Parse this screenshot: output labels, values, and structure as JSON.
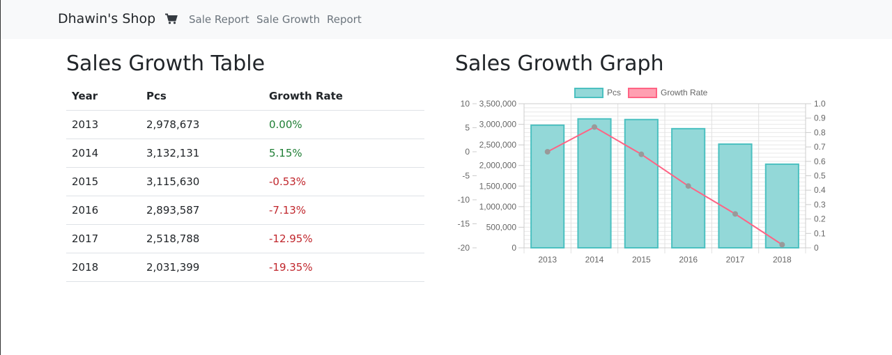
{
  "nav": {
    "brand": "Dhawin's Shop",
    "links": [
      "Sale Report",
      "Sale Growth",
      "Report"
    ]
  },
  "table_section": {
    "title": "Sales Growth Table",
    "headers": [
      "Year",
      "Pcs",
      "Growth Rate"
    ],
    "rows": [
      {
        "year": "2013",
        "pcs": "2,978,673",
        "rate": "0.00%",
        "trend": "pos"
      },
      {
        "year": "2014",
        "pcs": "3,132,131",
        "rate": "5.15%",
        "trend": "pos"
      },
      {
        "year": "2015",
        "pcs": "3,115,630",
        "rate": "-0.53%",
        "trend": "neg"
      },
      {
        "year": "2016",
        "pcs": "2,893,587",
        "rate": "-7.13%",
        "trend": "neg"
      },
      {
        "year": "2017",
        "pcs": "2,518,788",
        "rate": "-12.95%",
        "trend": "neg"
      },
      {
        "year": "2018",
        "pcs": "2,031,399",
        "rate": "-19.35%",
        "trend": "neg"
      }
    ]
  },
  "graph_section": {
    "title": "Sales Growth Graph"
  },
  "colors": {
    "positive": "#1e7e34",
    "negative": "#c0262c",
    "bar_fill": "#93d8d8",
    "bar_border": "#4bc0c0",
    "line": "#ff6384",
    "point": "#999999"
  },
  "icons": {
    "cart": "shopping-cart-icon"
  },
  "chart_data": {
    "type": "bar",
    "categories": [
      "2013",
      "2014",
      "2015",
      "2016",
      "2017",
      "2018"
    ],
    "legend": [
      "Pcs",
      "Growth Rate"
    ],
    "legend_position": "top",
    "grid": true,
    "series": [
      {
        "name": "Pcs",
        "type": "bar",
        "values": [
          2978673,
          3132131,
          3115630,
          2893587,
          2518788,
          2031399
        ]
      },
      {
        "name": "Growth Rate",
        "type": "line",
        "values": [
          0.0,
          5.15,
          -0.53,
          -7.13,
          -12.95,
          -19.35
        ]
      }
    ],
    "axes": {
      "y_pcs": {
        "range": [
          0,
          3500000
        ],
        "ticks": [
          "3,500,000",
          "3,000,000",
          "2,500,000",
          "2,000,000",
          "1,500,000",
          "1,000,000",
          "500,000",
          "0"
        ]
      },
      "y_rate": {
        "range": [
          -20,
          10
        ],
        "ticks": [
          "10",
          "5",
          "0",
          "-5",
          "-10",
          "-15",
          "-20"
        ]
      },
      "y_right": {
        "range": [
          0,
          1
        ],
        "ticks": [
          "1.0",
          "0.9",
          "0.8",
          "0.7",
          "0.6",
          "0.5",
          "0.4",
          "0.3",
          "0.2",
          "0.1",
          "0"
        ]
      }
    }
  }
}
